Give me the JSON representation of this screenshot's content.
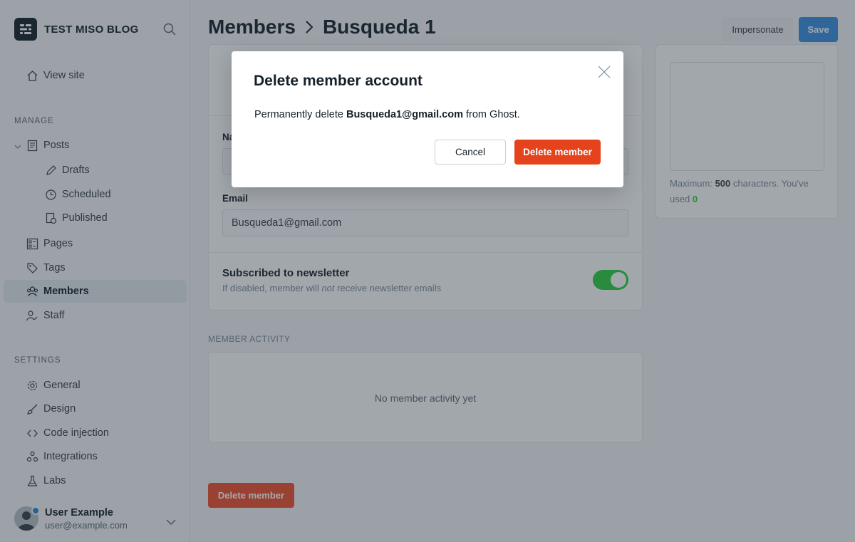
{
  "sidebar": {
    "brand_title": "TEST MISO BLOG",
    "brand_icon": "ghost-logo-icon",
    "view_site": "View site",
    "manage_label": "MANAGE",
    "settings_label": "SETTINGS",
    "items": {
      "posts": "Posts",
      "drafts": "Drafts",
      "scheduled": "Scheduled",
      "published": "Published",
      "pages": "Pages",
      "tags": "Tags",
      "members": "Members",
      "staff": "Staff",
      "general": "General",
      "design": "Design",
      "code_injection": "Code injection",
      "integrations": "Integrations",
      "labs": "Labs"
    },
    "user": {
      "name": "User Example",
      "email": "user@example.com"
    }
  },
  "header": {
    "breadcrumb_parent": "Members",
    "breadcrumb_current": "Busqueda 1",
    "impersonate_label": "Impersonate",
    "save_label": "Save"
  },
  "form": {
    "name_label_partial": "Na",
    "email_label": "Email",
    "email_value": "Busqueda1@gmail.com",
    "newsletter_title": "Subscribed to newsletter",
    "newsletter_desc_pre": "If disabled, member will ",
    "newsletter_desc_em": "not",
    "newsletter_desc_post": " receive newsletter emails",
    "newsletter_enabled": true,
    "note_pre": "Maximum: ",
    "note_max": "500",
    "note_mid": " characters. You've used ",
    "note_used": "0"
  },
  "activity": {
    "label": "MEMBER ACTIVITY",
    "empty_text": "No member activity yet"
  },
  "page_delete_label": "Delete member",
  "modal": {
    "title": "Delete member account",
    "body_pre": "Permanently delete ",
    "body_email": "Busqueda1@gmail.com",
    "body_post": " from Ghost.",
    "cancel_label": "Cancel",
    "delete_label": "Delete member"
  },
  "colors": {
    "danger": "#e5431c",
    "primary": "#3d8fe0",
    "toggle_on": "#30cf43"
  }
}
